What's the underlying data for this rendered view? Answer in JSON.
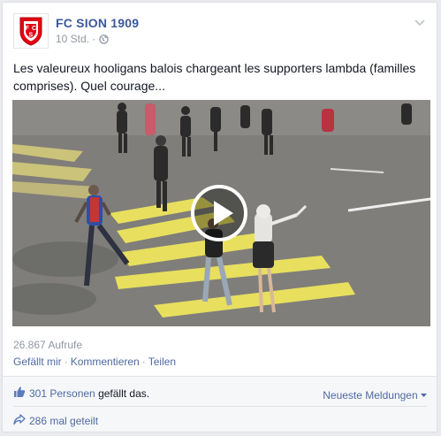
{
  "post": {
    "page_name": "FC SION 1909",
    "time": "10 Std.",
    "separator": "·",
    "privacy_icon": "globe-icon",
    "text": "Les valeureux hooligans balois chargeant les supporters lambda (familles comprises). Quel courage...",
    "logo_letters": "FCS"
  },
  "video": {
    "play_icon": "play-icon",
    "views": "26.867 Aufrufe"
  },
  "actions": {
    "like": "Gefällt mir",
    "comment": "Kommentieren",
    "share": "Teilen",
    "separator": "·"
  },
  "ufi": {
    "likes_count": "301 Personen",
    "likes_text": " gefällt das.",
    "sort_label": "Neueste Meldungen",
    "shares": "286 mal geteilt"
  },
  "colors": {
    "link": "#3b5998",
    "brand_red": "#e30613"
  }
}
